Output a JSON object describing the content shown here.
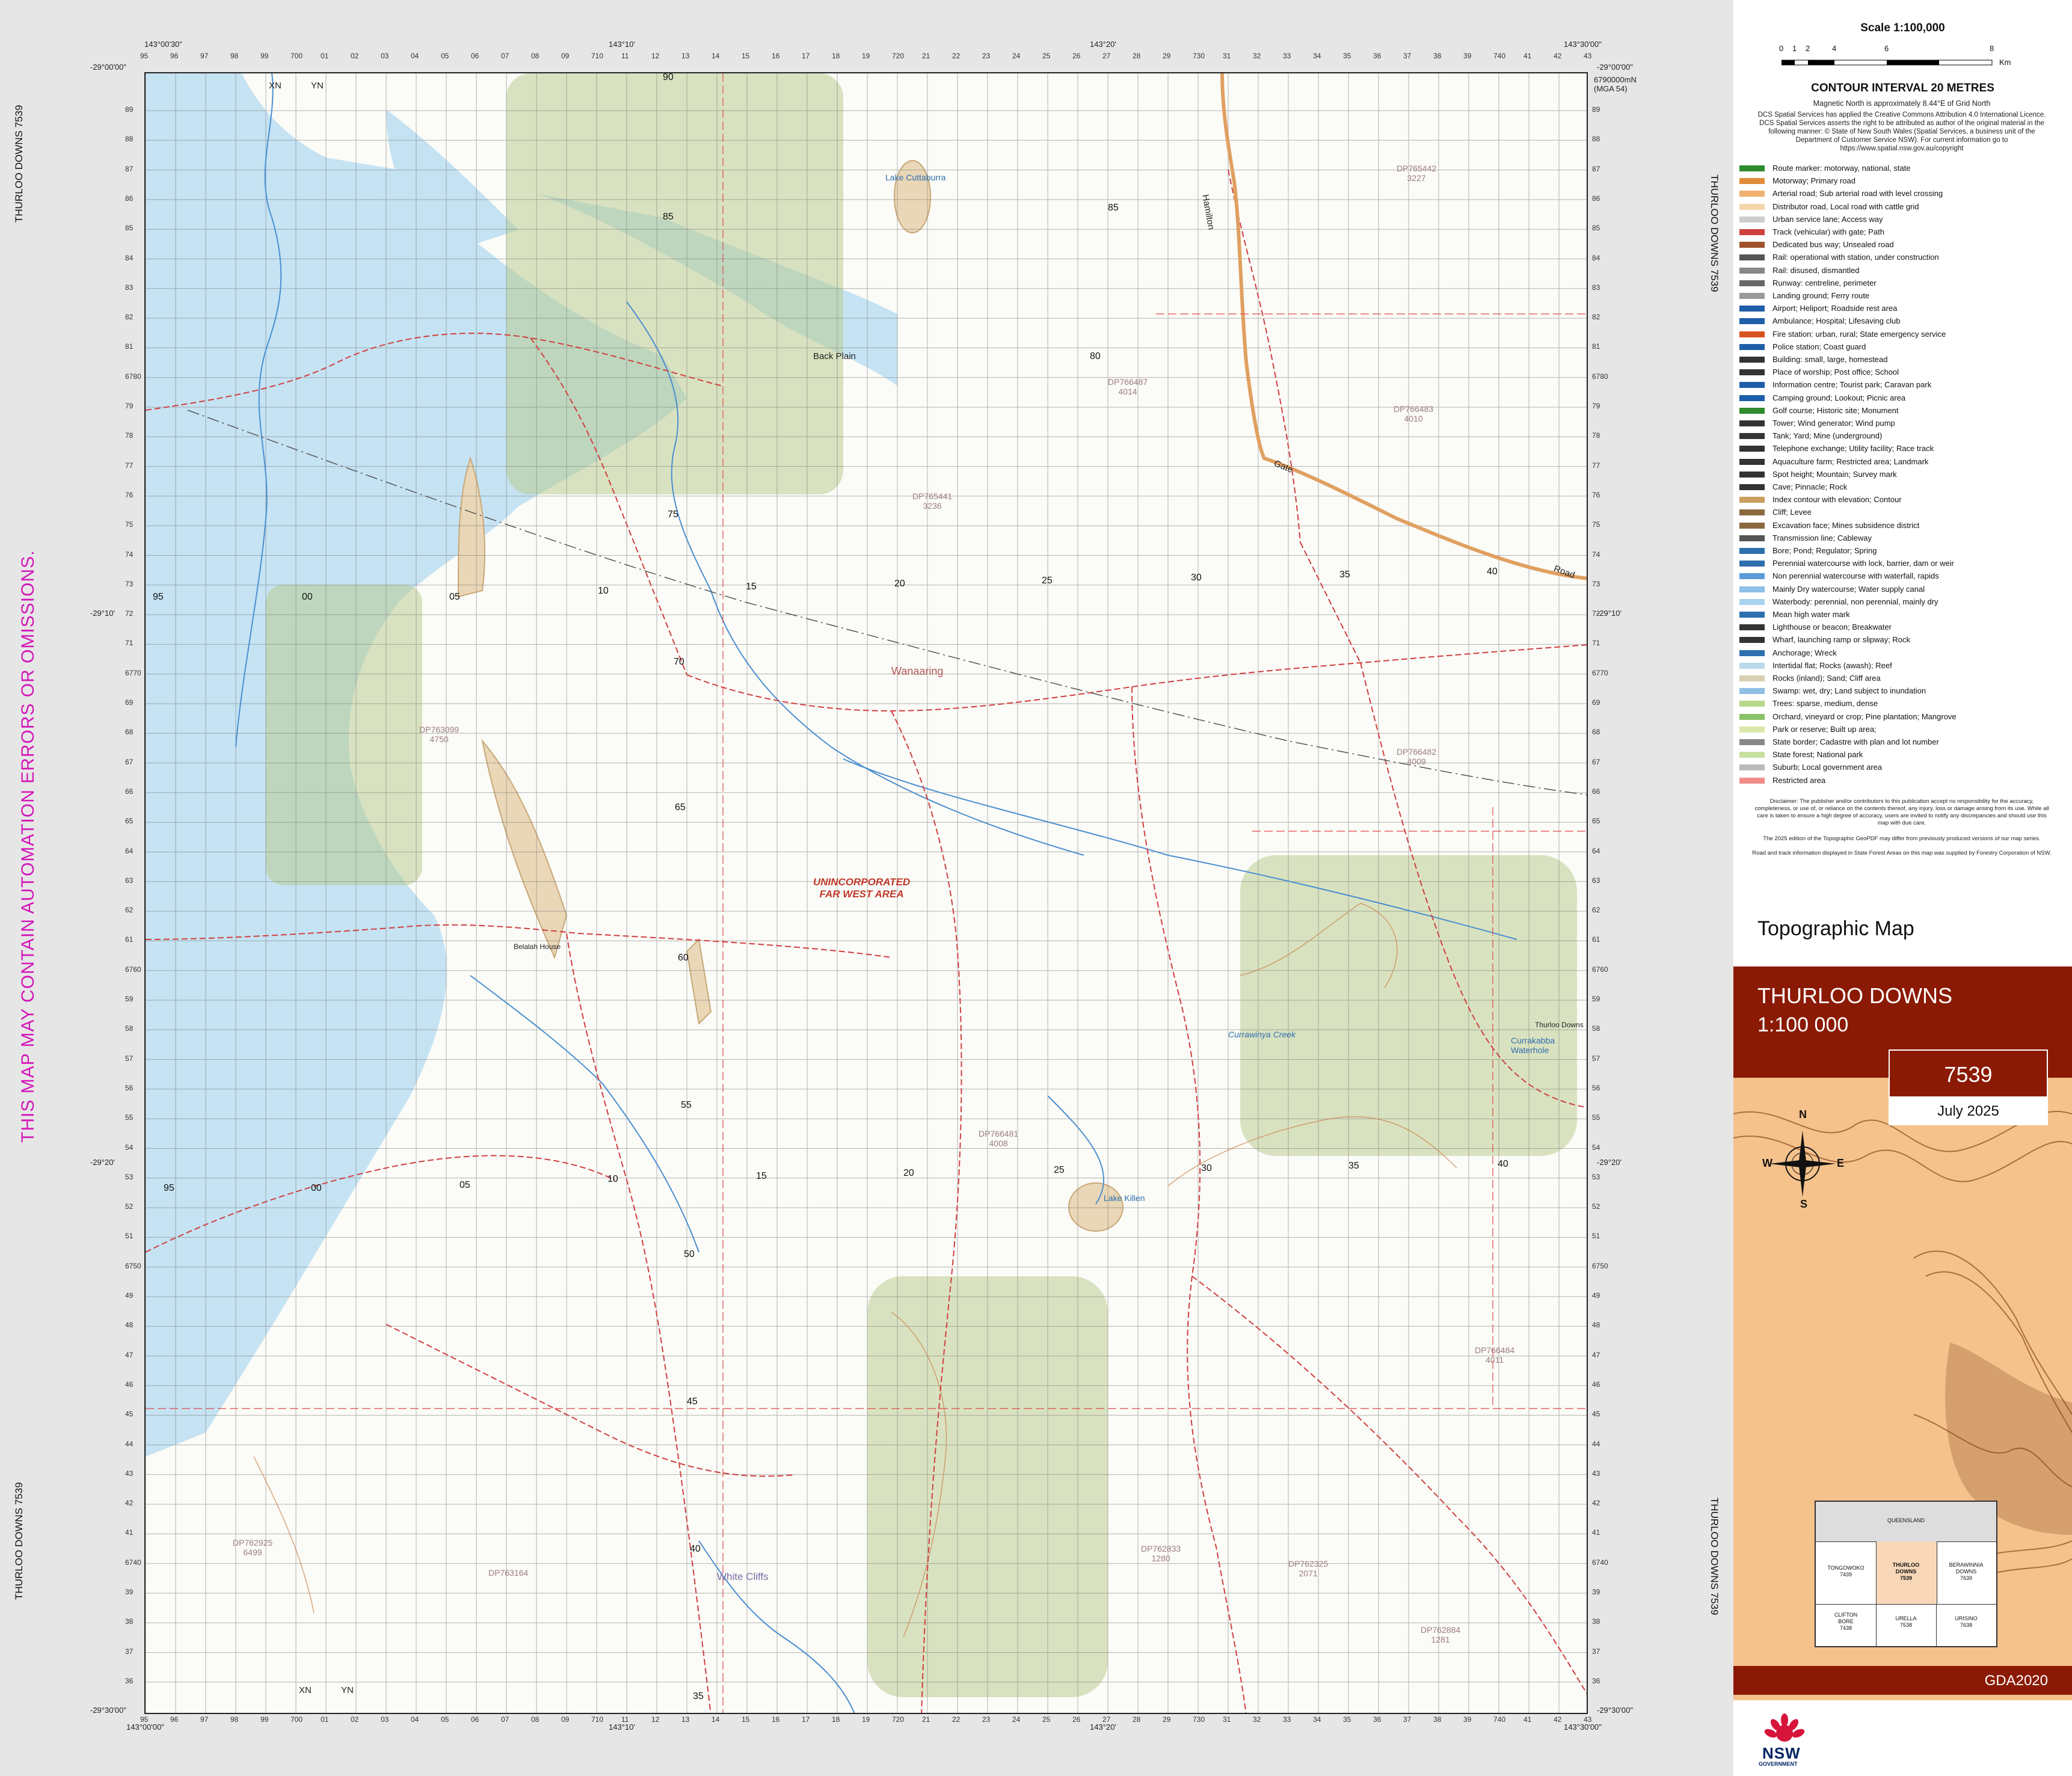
{
  "side_labels": {
    "left_top": "THURLOO DOWNS 7539",
    "left_bottom": "THURLOO DOWNS 7539",
    "right_top": "THURLOO DOWNS 7539",
    "right_bottom": "THURLOO DOWNS 7539",
    "warning": "THIS MAP MAY CONTAIN AUTOMATION ERRORS OR OMISSIONS."
  },
  "corners": {
    "top_left_lat": "-29°00'00\"",
    "top_right_lat": "-29°00'00\"",
    "bottom_left_lat": "-29°30'00\"",
    "bottom_right_lat": "-29°30'00\"",
    "top_left_lon": "143°00'30\"",
    "top_mid1_lon": "143°10'",
    "top_mid2_lon": "143°20'",
    "top_right_lon": "143°30'00\"",
    "bottom_left_lon": "143°00'00\"",
    "bottom_mid1_lon": "143°10'",
    "bottom_mid2_lon": "143°20'",
    "bottom_right_lon": "143°30'00\"",
    "lat_10": "-29°10'",
    "lat_20": "-29°20'",
    "top_easting_suffix": "700000mE",
    "northing_top": "6790000mN",
    "mga_zone": "(MGA 54)"
  },
  "top_eastings": [
    "95",
    "96",
    "97",
    "98",
    "99",
    "700",
    "01",
    "02",
    "03",
    "04",
    "05",
    "06",
    "07",
    "08",
    "09",
    "710",
    "11",
    "12",
    "13",
    "14",
    "15",
    "16",
    "17",
    "18",
    "19",
    "720",
    "21",
    "22",
    "23",
    "24",
    "25",
    "26",
    "27",
    "28",
    "29",
    "730",
    "31",
    "32",
    "33",
    "34",
    "35",
    "36",
    "37",
    "38",
    "39",
    "740",
    "41",
    "42",
    "43"
  ],
  "left_northings": [
    "89",
    "88",
    "87",
    "86",
    "85",
    "84",
    "83",
    "82",
    "81",
    "6780",
    "79",
    "78",
    "77",
    "76",
    "75",
    "74",
    "73",
    "72",
    "71",
    "6770",
    "69",
    "68",
    "67",
    "66",
    "65",
    "64",
    "63",
    "62",
    "61",
    "6760",
    "59",
    "58",
    "57",
    "56",
    "55",
    "54",
    "53",
    "52",
    "51",
    "6750",
    "49",
    "48",
    "47",
    "46",
    "45",
    "44",
    "43",
    "42",
    "41",
    "6740",
    "39",
    "38",
    "37",
    "36"
  ],
  "map_labels": {
    "xn1": "XN",
    "yn1": "YN",
    "xn2": "XN",
    "yn2": "YN",
    "back_plain": "Back Plain",
    "wanaaring": "Wanaaring",
    "unincorporated": "UNINCORPORATED",
    "far_west": "FAR WEST AREA",
    "belalah": "Belalah House",
    "lake_cuttaburra": "Lake Cuttaburra",
    "lake_killen": "Lake Killen",
    "currawinya": "Currawinya Creek",
    "currakabba": "Currakabba Waterhole",
    "thurloo_downs": "Thurloo Downs",
    "white_cliffs": "White Cliffs",
    "hamilton": "Hamilton",
    "gate": "Gate",
    "road": "Road",
    "dp765442": "DP765442",
    "dp765442n": "3227",
    "dp766487": "DP766487",
    "dp766487n": "4014",
    "dp766483": "DP766483",
    "dp766483n": "4010",
    "dp765441": "DP765441",
    "dp765441n": "3236",
    "dp766482": "DP766482",
    "dp766482n": "4009",
    "dp763099": "DP763099",
    "dp763099n": "4750",
    "dp766481": "DP766481",
    "dp766481n": "4008",
    "dp766484": "DP766484",
    "dp766484n": "4011",
    "dp762833": "DP762833",
    "dp762833n": "1280",
    "dp762325": "DP762325",
    "dp762325n": "2071",
    "dp762884": "DP762884",
    "dp762884n": "1281",
    "dp763164": "DP763164",
    "dp762925": "DP762925",
    "dp762925n": "6499",
    "grid_80": "80",
    "grid_75": "75",
    "grid_70": "70",
    "grid_65": "65",
    "grid_60": "60",
    "grid_55": "55",
    "grid_50": "50",
    "grid_45": "45",
    "grid_40": "40",
    "grid_35": "35",
    "grid_85": "85",
    "grid_90": "90",
    "col_95": "95",
    "col_00": "00",
    "col_05": "05",
    "col_10": "10",
    "col_15": "15",
    "col_20": "20",
    "col_25": "25",
    "col_30": "30",
    "col_35": "35",
    "col_40": "40"
  },
  "legend": {
    "scale": "Scale 1:100,000",
    "scale_ticks": [
      "0",
      "1",
      "2",
      "4",
      "6",
      "8"
    ],
    "scale_unit": "Km",
    "contour": "CONTOUR INTERVAL 20 METRES",
    "magnetic": "Magnetic North is approximately 8.44°E of Grid North",
    "copyright": "DCS Spatial Services has applied the Creative Commons Attribution 4.0 International Licence. DCS Spatial Services asserts the right to be attributed as author of the original material in the following manner: © State of New South Wales (Spatial Services, a business unit of the Department of Customer Service NSW). For current information go to https://www.spatial.nsw.gov.au/copyright",
    "items": [
      {
        "label": "Route marker: motorway, national, state",
        "color": "#2e8b2e"
      },
      {
        "label": "Motorway; Primary road",
        "color": "#e08c3a"
      },
      {
        "label": "Arterial road; Sub arterial road with level crossing",
        "color": "#f0b070"
      },
      {
        "label": "Distributor road, Local road with cattle grid",
        "color": "#f3d6a8"
      },
      {
        "label": "Urban service lane; Access way",
        "color": "#cccccc"
      },
      {
        "label": "Track (vehicular) with gate; Path",
        "color": "#d04040"
      },
      {
        "label": "Dedicated bus way; Unsealed road",
        "color": "#a0522d"
      },
      {
        "label": "Rail: operational with station, under construction",
        "color": "#555555"
      },
      {
        "label": "Rail: disused, dismantled",
        "color": "#888888"
      },
      {
        "label": "Runway: centreline, perimeter",
        "color": "#666666"
      },
      {
        "label": "Landing ground; Ferry route",
        "color": "#999999"
      },
      {
        "label": "Airport; Heliport; Roadside rest area",
        "color": "#1f5ea8"
      },
      {
        "label": "Ambulance; Hospital; Lifesaving club",
        "color": "#1f5ea8"
      },
      {
        "label": "Fire station: urban, rural; State emergency service",
        "color": "#d9531e"
      },
      {
        "label": "Police station; Coast guard",
        "color": "#1f5ea8"
      },
      {
        "label": "Building: small, large, homestead",
        "color": "#333333"
      },
      {
        "label": "Place of worship; Post office; School",
        "color": "#333333"
      },
      {
        "label": "Information centre; Tourist park; Caravan park",
        "color": "#1f5ea8"
      },
      {
        "label": "Camping ground; Lookout; Picnic area",
        "color": "#1f5ea8"
      },
      {
        "label": "Golf course; Historic site; Monument",
        "color": "#2e8b2e"
      },
      {
        "label": "Tower; Wind generator; Wind pump",
        "color": "#333333"
      },
      {
        "label": "Tank; Yard; Mine (underground)",
        "color": "#333333"
      },
      {
        "label": "Telephone exchange; Utility facility; Race track",
        "color": "#333333"
      },
      {
        "label": "Aquaculture farm; Restricted area; Landmark",
        "color": "#333333"
      },
      {
        "label": "Spot height; Mountain; Survey mark",
        "color": "#333333"
      },
      {
        "label": "Cave; Pinnacle; Rock",
        "color": "#333333"
      },
      {
        "label": "Index contour with elevation; Contour",
        "color": "#c8a060"
      },
      {
        "label": "Cliff; Levee",
        "color": "#8b6a40"
      },
      {
        "label": "Excavation face; Mines subsidence district",
        "color": "#8b6a40"
      },
      {
        "label": "Transmission line; Cableway",
        "color": "#555555"
      },
      {
        "label": "Bore; Pond; Regulator; Spring",
        "color": "#2e6fae"
      },
      {
        "label": "Perennial watercourse with lock, barrier, dam or weir",
        "color": "#2e6fae"
      },
      {
        "label": "Non perennial watercourse with waterfall, rapids",
        "color": "#5a9ad6"
      },
      {
        "label": "Mainly Dry watercourse; Water supply canal",
        "color": "#8fbfe6"
      },
      {
        "label": "Waterbody: perennial, non perennial, mainly dry",
        "color": "#a9d3f0"
      },
      {
        "label": "Mean high water mark",
        "color": "#2e6fae"
      },
      {
        "label": "Lighthouse or beacon; Breakwater",
        "color": "#333333"
      },
      {
        "label": "Wharf, launching ramp or slipway; Rock",
        "color": "#333333"
      },
      {
        "label": "Anchorage; Wreck",
        "color": "#2e6fae"
      },
      {
        "label": "Intertidal flat; Rocks (awash); Reef",
        "color": "#b9dbe9"
      },
      {
        "label": "Rocks (inland); Sand; Cliff area",
        "color": "#d9cfb3"
      },
      {
        "label": "Swamp: wet, dry; Land subject to inundation",
        "color": "#8fbfe6"
      },
      {
        "label": "Trees: sparse, medium, dense",
        "color": "#b7d98c"
      },
      {
        "label": "Orchard, vineyard or crop; Pine plantation; Mangrove",
        "color": "#8cc26a"
      },
      {
        "label": "Park or reserve; Built up area;",
        "color": "#d9e8a8"
      },
      {
        "label": "State border; Cadastre with plan and lot number",
        "color": "#888888"
      },
      {
        "label": "State forest; National park",
        "color": "#c8e0a0"
      },
      {
        "label": "Suburb; Local government area",
        "color": "#bbbbbb"
      },
      {
        "label": "Restricted area",
        "color": "#f28c8c"
      }
    ],
    "disclaimer": "Disclaimer: The publisher and/or contributors to this publication accept no responsibility for the accuracy, completeness, or use of, or reliance on the contents thereof, any injury, loss or damage arising from its use. While all care is taken to ensure a high degree of accuracy, users are invited to notify any discrepancies and should use this map with due care.",
    "edition_note": "The 2025 edition of the Topographic GeoPDF may differ from previously produced versions of our map series.",
    "forestry_note": "Road and track information displayed in State Forest Areas on this map was supplied by Forestry Corporation of NSW."
  },
  "cover": {
    "heading": "Topographic Map",
    "map_name": "THURLOO DOWNS",
    "map_scale": "1:100 000",
    "map_number": "7539",
    "date": "July 2025",
    "datum": "GDA2020",
    "compass_n": "N",
    "compass_s": "S",
    "compass_e": "E",
    "compass_w": "W",
    "inset": {
      "queensland": "QUEENSLAND",
      "tongowoko": "TONGOWOKO\n7439",
      "thurloo": "THURLOO\nDOWNS\n7539",
      "berawinnia": "BERAWINNIA\nDOWNS\n7639",
      "clifton": "CLIFTON\nBORE\n7438",
      "urella": "URELLA\n7538",
      "urisino": "URISINO\n7638"
    },
    "logo_text": "NSW",
    "logo_sub": "GOVERNMENT"
  },
  "colors": {
    "brand": "#8b1a05",
    "water": "#bfe0f2",
    "road": "#d04040",
    "highway": "#e0a060",
    "cover_bg": "#f5c28c",
    "contour": "#c8824a"
  }
}
